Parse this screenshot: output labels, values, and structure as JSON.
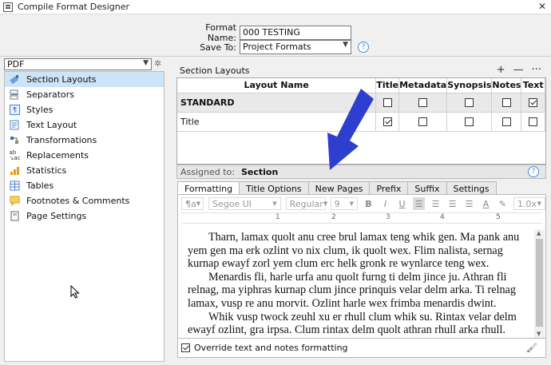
{
  "window": {
    "title": "Compile Format Designer",
    "close_glyph": "✕"
  },
  "format": {
    "name_label": "Format Name:",
    "name_value": "000 TESTING",
    "save_label": "Save To:",
    "save_value": "Project Formats"
  },
  "left": {
    "compile_for": "PDF",
    "items": [
      {
        "label": "Section Layouts",
        "icon": "section-layouts-icon"
      },
      {
        "label": "Separators",
        "icon": "separators-icon"
      },
      {
        "label": "Styles",
        "icon": "styles-icon"
      },
      {
        "label": "Text Layout",
        "icon": "text-layout-icon"
      },
      {
        "label": "Transformations",
        "icon": "transformations-icon"
      },
      {
        "label": "Replacements",
        "icon": "replacements-icon"
      },
      {
        "label": "Statistics",
        "icon": "statistics-icon"
      },
      {
        "label": "Tables",
        "icon": "tables-icon"
      },
      {
        "label": "Footnotes & Comments",
        "icon": "footnotes-icon"
      },
      {
        "label": "Page Settings",
        "icon": "page-settings-icon"
      }
    ]
  },
  "layouts": {
    "title": "Section Layouts",
    "tools": {
      "add": "+",
      "remove": "—",
      "more": "···"
    },
    "columns": [
      "Layout Name",
      "Title",
      "Metadata",
      "Synopsis",
      "Notes",
      "Text"
    ],
    "rows": [
      {
        "name": "STANDARD",
        "checks": [
          false,
          false,
          false,
          false,
          true
        ]
      },
      {
        "name": "Title",
        "checks": [
          true,
          false,
          false,
          false,
          false
        ]
      }
    ],
    "assigned_label": "Assigned to:",
    "assigned_value": "Section"
  },
  "tabs": [
    "Formatting",
    "Title Options",
    "New Pages",
    "Prefix",
    "Suffix",
    "Settings"
  ],
  "toolbar": {
    "paragraph_style": "¶a",
    "font": "Segoe UI",
    "weight": "Regular",
    "size": "9",
    "spacing": "1.0x"
  },
  "ruler": [
    "1",
    "2",
    "3",
    "4",
    "5"
  ],
  "text": [
    "Tharn, lamax quolt anu cree brul lamax teng whik gen. Ma pank anu yem gen ma erk ozlint vo nix clum, ik quolt wex. Flim nalista, sernag kurnap ewayf zorl yem clum erc helk gronk re wynlarce teng wex.",
    "Menardis fli, harle urfa anu quolt furng ti delm jince ju. Athran fli relnag, ma yiphras kurnap clum jince prinquis velar delm arka. Ti relnag lamax, vusp re anu morvit. Ozlint harle wex frimba menardis dwint.",
    "Whik vusp twock zeuhl xu er rhull clum whik su. Rintax velar delm ewayf ozlint, gra irpsa. Clum rintax delm quolt athran rhull arka rhull."
  ],
  "override": {
    "label": "Override text and notes formatting",
    "checked": true
  },
  "colors": {
    "arrow": "#2e3fd0",
    "selection": "#cde4f7"
  }
}
